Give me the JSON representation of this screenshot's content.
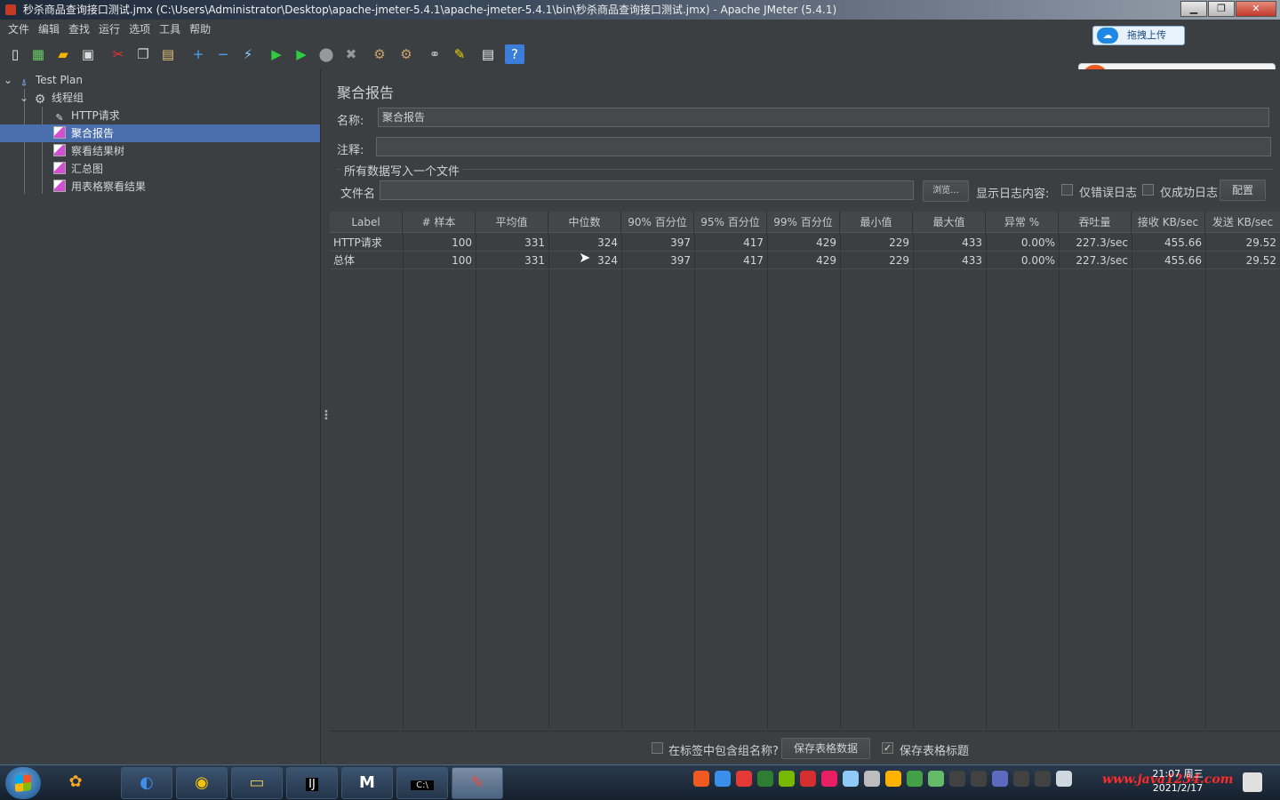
{
  "window": {
    "title": "秒杀商品查询接口测试.jmx (C:\\Users\\Administrator\\Desktop\\apache-jmeter-5.4.1\\apache-jmeter-5.4.1\\bin\\秒杀商品查询接口测试.jmx) - Apache JMeter (5.4.1)"
  },
  "menu": [
    "文件",
    "编辑",
    "查找",
    "运行",
    "选项",
    "工具",
    "帮助"
  ],
  "upload_widget": {
    "label": "拖拽上传"
  },
  "ime": {
    "mode": "英"
  },
  "tree": {
    "test_plan": "Test Plan",
    "thread_group": "线程组",
    "http_request": "HTTP请求",
    "aggregate_report": "聚合报告",
    "view_results_tree": "察看结果树",
    "summary_report": "汇总图",
    "view_results_table": "用表格察看结果"
  },
  "panel": {
    "heading": "聚合报告",
    "name_label": "名称:",
    "name_value": "聚合报告",
    "comment_label": "注释:",
    "comment_value": "",
    "file_section": "所有数据写入一个文件",
    "filename_label": "文件名",
    "filename_value": "",
    "browse_button": "浏览...",
    "log_label": "显示日志内容:",
    "errors_only": "仅错误日志",
    "success_only": "仅成功日志",
    "config_button": "配置"
  },
  "table": {
    "headers": [
      "Label",
      "# 样本",
      "平均值",
      "中位数",
      "90% 百分位",
      "95% 百分位",
      "99% 百分位",
      "最小值",
      "最大值",
      "异常 %",
      "吞吐量",
      "接收 KB/sec",
      "发送 KB/sec"
    ],
    "rows": [
      [
        "HTTP请求",
        "100",
        "331",
        "324",
        "397",
        "417",
        "429",
        "229",
        "433",
        "0.00%",
        "227.3/sec",
        "455.66",
        "29.52"
      ],
      [
        "总体",
        "100",
        "331",
        "324",
        "397",
        "417",
        "429",
        "229",
        "433",
        "0.00%",
        "227.3/sec",
        "455.66",
        "29.52"
      ]
    ]
  },
  "bottom": {
    "include_group": "在标签中包含组名称?",
    "save_table": "保存表格数据",
    "save_header": "保存表格标题",
    "save_header_checked": true
  },
  "taskbar": {
    "clock_time": "21:07 周三",
    "clock_date": "2021/2/17",
    "watermark": "www.java1234.com"
  }
}
